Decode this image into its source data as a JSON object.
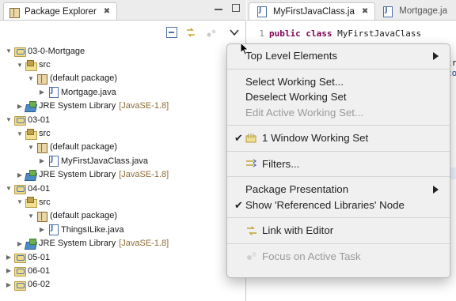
{
  "package_explorer": {
    "title": "Package Explorer",
    "tree": [
      {
        "level": 0,
        "expanded": true,
        "icon": "project-folder-icon",
        "label": "03-0-Mortgage"
      },
      {
        "level": 1,
        "expanded": true,
        "icon": "source-folder-icon",
        "label": "src"
      },
      {
        "level": 2,
        "expanded": true,
        "icon": "package-icon",
        "label": "(default package)"
      },
      {
        "level": 3,
        "expanded": false,
        "icon": "java-file-icon",
        "label": "Mortgage.java"
      },
      {
        "level": 1,
        "expanded": false,
        "icon": "jre-library-icon",
        "label": "JRE System Library",
        "suffix": "[JavaSE-1.8]"
      },
      {
        "level": 0,
        "expanded": true,
        "icon": "project-folder-icon",
        "label": "03-01"
      },
      {
        "level": 1,
        "expanded": true,
        "icon": "source-folder-icon",
        "label": "src"
      },
      {
        "level": 2,
        "expanded": true,
        "icon": "package-icon",
        "label": "(default package)"
      },
      {
        "level": 3,
        "expanded": false,
        "icon": "java-file-icon",
        "label": "MyFirstJavaClass.java"
      },
      {
        "level": 1,
        "expanded": false,
        "icon": "jre-library-icon",
        "label": "JRE System Library",
        "suffix": "[JavaSE-1.8]"
      },
      {
        "level": 0,
        "expanded": true,
        "icon": "project-folder-icon",
        "label": "04-01"
      },
      {
        "level": 1,
        "expanded": true,
        "icon": "source-folder-icon",
        "label": "src"
      },
      {
        "level": 2,
        "expanded": true,
        "icon": "package-icon",
        "label": "(default package)"
      },
      {
        "level": 3,
        "expanded": false,
        "icon": "java-file-icon",
        "label": "ThingsILike.java"
      },
      {
        "level": 1,
        "expanded": false,
        "icon": "jre-library-icon",
        "label": "JRE System Library",
        "suffix": "[JavaSE-1.8]"
      },
      {
        "level": 0,
        "expanded": false,
        "icon": "project-folder-icon",
        "label": "05-01"
      },
      {
        "level": 0,
        "expanded": false,
        "icon": "project-folder-icon",
        "label": "06-01"
      },
      {
        "level": 0,
        "expanded": false,
        "icon": "project-folder-icon",
        "label": "06-02"
      }
    ]
  },
  "editor": {
    "tabs": [
      {
        "label": "MyFirstJavaClass.ja",
        "active": true
      },
      {
        "label": "Mortgage.ja",
        "active": false
      }
    ],
    "line_number": "1",
    "line1_keyword": "public class",
    "line1_rest": "MyFirstJavaClass",
    "frag_a": "tr",
    "frag_b": "co"
  },
  "view_menu": {
    "items": [
      {
        "type": "item",
        "label": "Top Level Elements",
        "submenu": true
      },
      {
        "type": "separator"
      },
      {
        "type": "item",
        "label": "Select Working Set..."
      },
      {
        "type": "item",
        "label": "Deselect Working Set"
      },
      {
        "type": "item",
        "label": "Edit Active Working Set...",
        "disabled": true
      },
      {
        "type": "separator"
      },
      {
        "type": "item",
        "label": "1 Window Working Set",
        "checked": true,
        "icon": "working-set-icon"
      },
      {
        "type": "separator"
      },
      {
        "type": "item",
        "label": "Filters...",
        "icon": "filter-icon"
      },
      {
        "type": "separator"
      },
      {
        "type": "item",
        "label": "Package Presentation",
        "submenu": true
      },
      {
        "type": "item",
        "label": "Show 'Referenced Libraries' Node",
        "checked": true
      },
      {
        "type": "separator"
      },
      {
        "type": "item",
        "label": "Link with Editor",
        "icon": "link-editor-icon"
      },
      {
        "type": "separator"
      },
      {
        "type": "item",
        "label": "Focus on Active Task",
        "icon": "focus-task-icon",
        "disabled": true
      }
    ]
  },
  "colors": {
    "keyword": "#7f0055",
    "library_suffix": "#8b6b33",
    "menu_bg": "#f0f0f0",
    "disabled_text": "#9a9a9a"
  }
}
